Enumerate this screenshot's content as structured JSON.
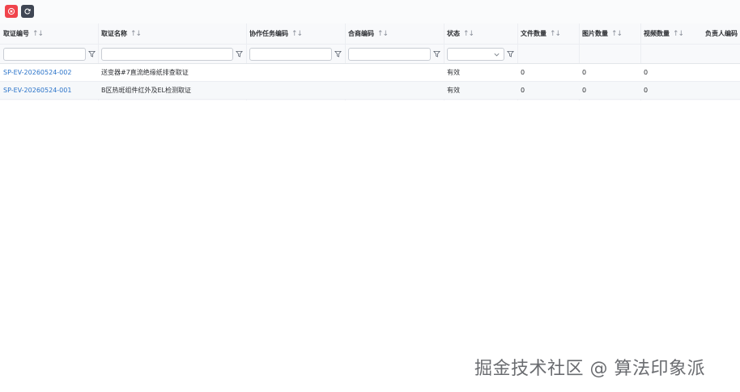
{
  "toolbar": {
    "buttons": [
      {
        "name": "clear-filter",
        "icon": "close-circle-icon",
        "color": "#f0444c"
      },
      {
        "name": "refresh",
        "icon": "refresh-icon",
        "color": "#3f4654"
      }
    ]
  },
  "table": {
    "columns": [
      {
        "label": "取证编号",
        "sortable": true
      },
      {
        "label": "取证名称",
        "sortable": true
      },
      {
        "label": "协作任务编码",
        "sortable": true
      },
      {
        "label": "合商编码",
        "sortable": true
      },
      {
        "label": "状态",
        "sortable": true
      },
      {
        "label": "文件数量",
        "sortable": true
      },
      {
        "label": "图片数量",
        "sortable": true
      },
      {
        "label": "视频数量",
        "sortable": true
      },
      {
        "label": "负责人编码",
        "sortable": false
      }
    ],
    "sort_glyph": "↑↓",
    "filters": {
      "evidence_code": "",
      "evidence_name": "",
      "task_code": "",
      "merchant_code": "",
      "status": ""
    },
    "rows": [
      {
        "evidence_code": "SP-EV-20260524-002",
        "evidence_name": "送变器#7直流绝缘纸排查取证",
        "task_code": "",
        "merchant_code": "",
        "status": "有效",
        "file_count": "0",
        "image_count": "0",
        "video_count": "0",
        "owner_code": ""
      },
      {
        "evidence_code": "SP-EV-20260524-001",
        "evidence_name": "B区热斑组件红外及EL检测取证",
        "task_code": "",
        "merchant_code": "",
        "status": "有效",
        "file_count": "0",
        "image_count": "0",
        "video_count": "0",
        "owner_code": ""
      }
    ]
  },
  "watermark": "掘金技术社区 @ 算法印象派"
}
